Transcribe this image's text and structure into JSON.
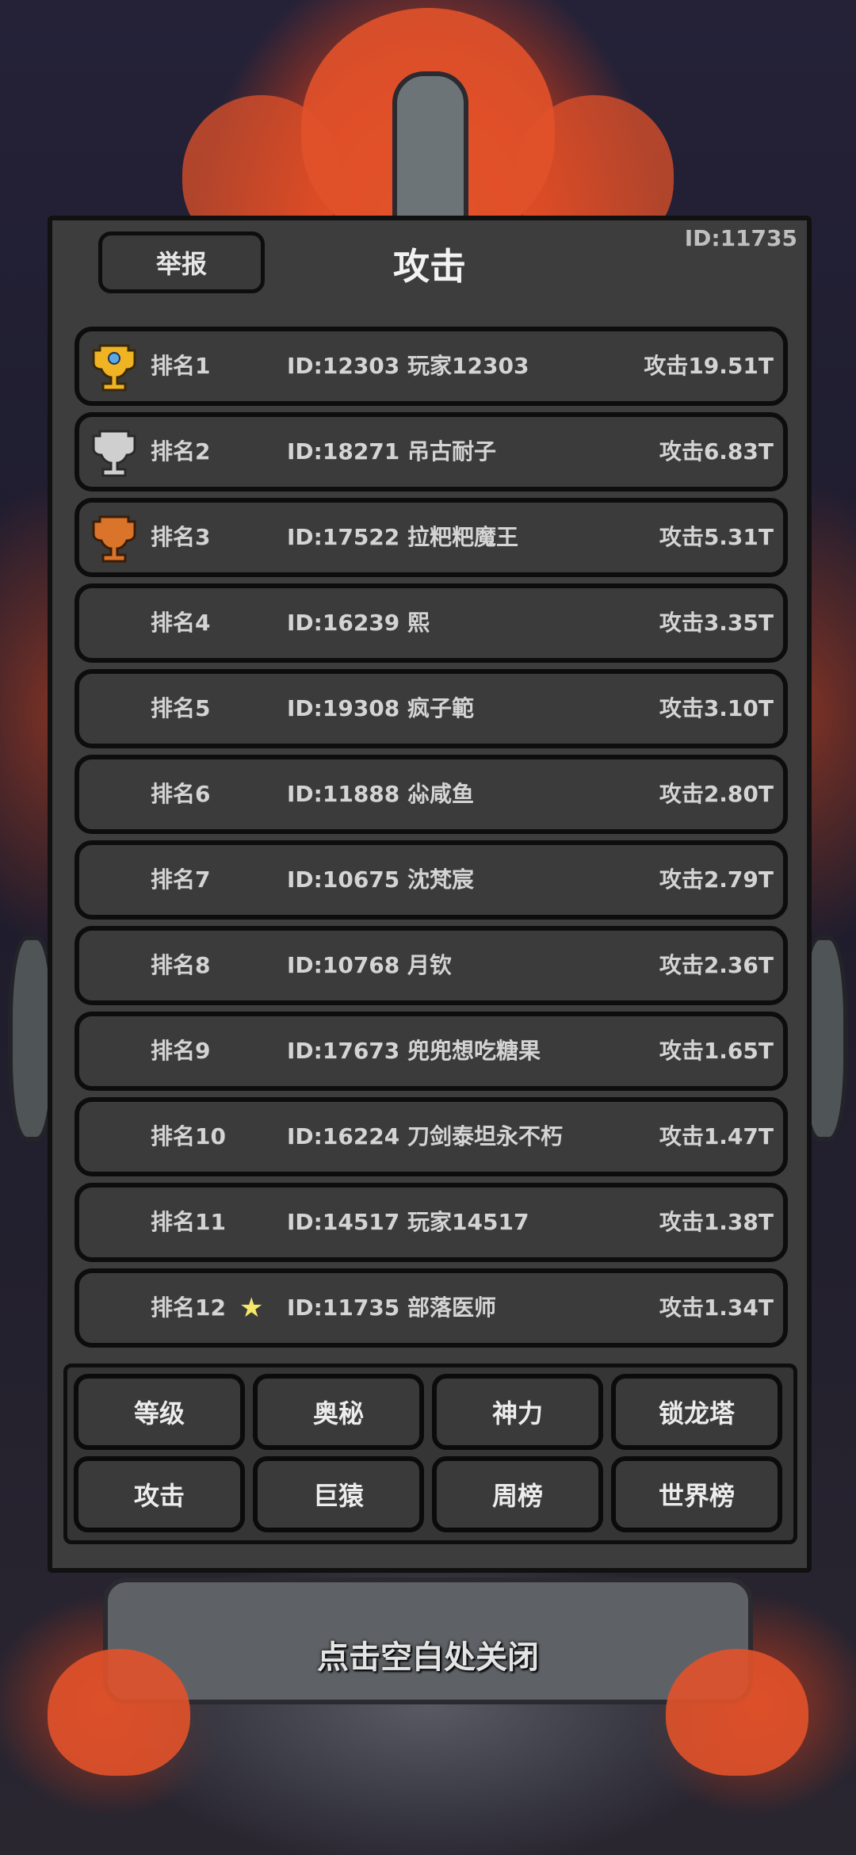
{
  "header": {
    "user_id": "ID:11735",
    "report_label": "举报",
    "title": "攻击"
  },
  "rankings": [
    {
      "rank": "排名1",
      "player": "ID:12303 玩家12303",
      "power": "攻击19.51T",
      "trophy": "gold-trophy-icon"
    },
    {
      "rank": "排名2",
      "player": "ID:18271 吊古耐子",
      "power": "攻击6.83T",
      "trophy": "silver-trophy-icon"
    },
    {
      "rank": "排名3",
      "player": "ID:17522 拉粑粑魔王",
      "power": "攻击5.31T",
      "trophy": "bronze-trophy-icon"
    },
    {
      "rank": "排名4",
      "player": "ID:16239 熙",
      "power": "攻击3.35T"
    },
    {
      "rank": "排名5",
      "player": "ID:19308 疯子範",
      "power": "攻击3.10T"
    },
    {
      "rank": "排名6",
      "player": "ID:11888 尛咸鱼",
      "power": "攻击2.80T"
    },
    {
      "rank": "排名7",
      "player": "ID:10675 沈梵宸",
      "power": "攻击2.79T"
    },
    {
      "rank": "排名8",
      "player": "ID:10768 月钦",
      "power": "攻击2.36T"
    },
    {
      "rank": "排名9",
      "player": "ID:17673 兜兜想吃糖果",
      "power": "攻击1.65T"
    },
    {
      "rank": "排名10",
      "player": "ID:16224 刀剑泰坦永不朽",
      "power": "攻击1.47T"
    },
    {
      "rank": "排名11",
      "player": "ID:14517 玩家14517",
      "power": "攻击1.38T"
    },
    {
      "rank": "排名12",
      "player": "ID:11735 部落医师",
      "power": "攻击1.34T",
      "marker": "★"
    }
  ],
  "tabs": [
    "等级",
    "奥秘",
    "神力",
    "锁龙塔",
    "攻击",
    "巨猿",
    "周榜",
    "世界榜"
  ],
  "close_hint": "点击空白处关闭",
  "colors": {
    "gold": "#f0b323",
    "silver": "#cfcfcf",
    "bronze": "#d9742a",
    "panel": "#3d3d3d",
    "fire": "#e2522a"
  }
}
